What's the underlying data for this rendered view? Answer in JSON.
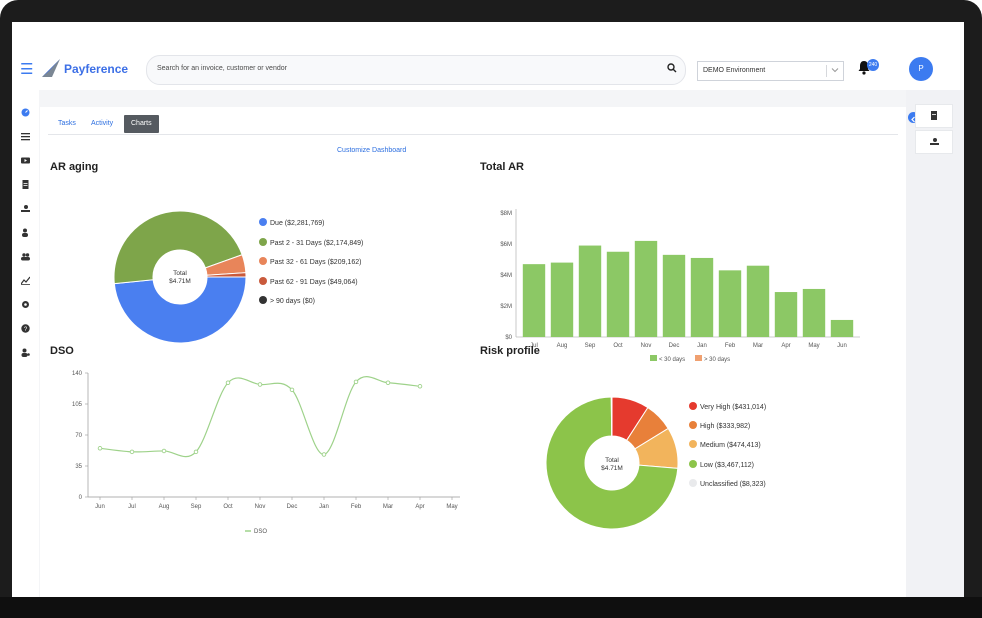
{
  "app": {
    "brand": "Payference"
  },
  "search": {
    "placeholder": "Search for an invoice, customer or vendor"
  },
  "environment": {
    "selected": "DEMO Environment"
  },
  "notifications": {
    "count": "240"
  },
  "user": {
    "initial": "P"
  },
  "tabs": [
    {
      "label": "Tasks",
      "active": false
    },
    {
      "label": "Activity",
      "active": false
    },
    {
      "label": "Charts",
      "active": true
    }
  ],
  "customize_label": "Customize Dashboard",
  "colors": {
    "accent": "#3c7bf0",
    "green": "#8cc865",
    "orange": "#f0a070"
  },
  "sidebar_icons": [
    "dashboard-icon",
    "list-icon",
    "video-icon",
    "document-icon",
    "receive-payment-icon",
    "customer-icon",
    "users-icon",
    "chart-icon",
    "settings-icon",
    "help-icon",
    "user-settings-icon"
  ],
  "chart_data": [
    {
      "type": "pie",
      "title": "AR aging",
      "center_label": [
        "Total",
        "$4.71M"
      ],
      "slices": [
        {
          "label": "Due ($2,281,769)",
          "value": 2281769,
          "color": "#4a7ff0"
        },
        {
          "label": "Past 2 - 31 Days ($2,174,849)",
          "value": 2174849,
          "color": "#7ea54a"
        },
        {
          "label": "Past 32 - 61 Days ($209,162)",
          "value": 209162,
          "color": "#e8855a"
        },
        {
          "label": "Past 62 - 91 Days ($49,064)",
          "value": 49064,
          "color": "#c95a3c"
        },
        {
          "label": "> 90 days ($0)",
          "value": 0,
          "color": "#333333"
        }
      ]
    },
    {
      "type": "bar",
      "title": "Total AR",
      "categories": [
        "Jul",
        "Aug",
        "Sep",
        "Oct",
        "Nov",
        "Dec",
        "Jan",
        "Feb",
        "Mar",
        "Apr",
        "May",
        "Jun"
      ],
      "series": [
        {
          "name": "< 30 days",
          "color": "#8cc865",
          "values": [
            4.7,
            4.8,
            5.9,
            5.5,
            6.2,
            5.3,
            5.1,
            4.3,
            4.6,
            2.9,
            3.1,
            1.1
          ]
        },
        {
          "name": "> 30 days",
          "color": "#f0a070",
          "values": [
            0,
            0,
            0,
            0,
            0,
            0,
            0,
            0,
            0,
            0,
            0,
            0
          ]
        }
      ],
      "yticks": [
        "$0",
        "$2M",
        "$4M",
        "$6M",
        "$8M"
      ],
      "ylim": [
        0,
        8
      ]
    },
    {
      "type": "line",
      "title": "DSO",
      "categories": [
        "Jun",
        "Jul",
        "Aug",
        "Sep",
        "Oct",
        "Nov",
        "Dec",
        "Jan",
        "Feb",
        "Mar",
        "Apr",
        "May"
      ],
      "series": [
        {
          "name": "DSO",
          "color": "#9ed28a",
          "values": [
            55,
            51,
            52,
            51,
            129,
            127,
            121,
            48,
            130,
            129,
            125,
            null
          ]
        }
      ],
      "yticks": [
        "0",
        "35",
        "70",
        "105",
        "140"
      ],
      "ylim": [
        0,
        140
      ]
    },
    {
      "type": "pie",
      "title": "Risk profile",
      "center_label": [
        "Total",
        "$4.71M"
      ],
      "slices": [
        {
          "label": "Very High ($431,014)",
          "value": 431014,
          "color": "#e53a2e"
        },
        {
          "label": "High ($333,982)",
          "value": 333982,
          "color": "#e8803a"
        },
        {
          "label": "Medium ($474,413)",
          "value": 474413,
          "color": "#f2b45c"
        },
        {
          "label": "Low ($3,467,112)",
          "value": 3467112,
          "color": "#8cc44a"
        },
        {
          "label": "Unclassified ($8,323)",
          "value": 8323,
          "color": "#e9eaec"
        }
      ]
    }
  ]
}
